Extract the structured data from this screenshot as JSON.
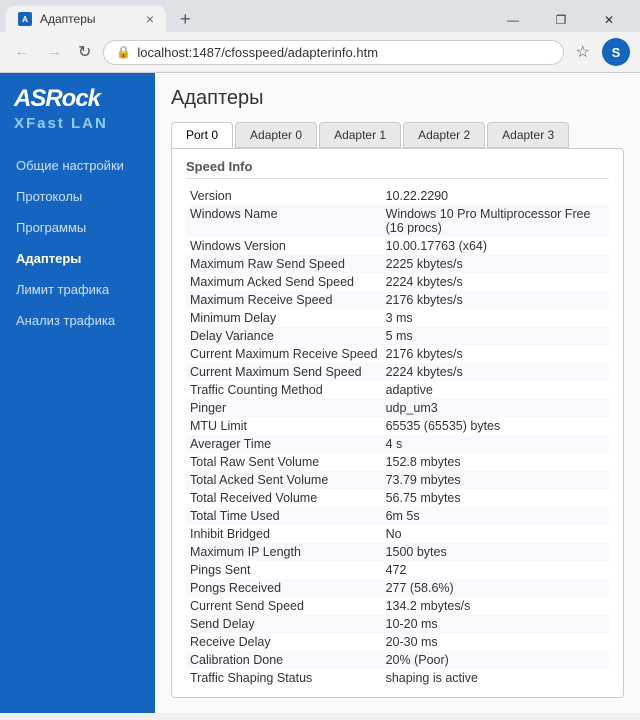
{
  "browser": {
    "tab_title": "Адаптеры",
    "tab_close": "×",
    "new_tab": "+",
    "back": "←",
    "forward": "→",
    "refresh": "↻",
    "url": "localhost:1487/cfosspeed/adapterinfo.htm",
    "star_icon": "☆",
    "profile_letter": "S",
    "win_minimize": "—",
    "win_restore": "❐",
    "win_close": "✕"
  },
  "sidebar": {
    "logo_main": "ASRock",
    "logo_sub": "XFast LAN",
    "items": [
      {
        "label": "Общие настройки",
        "active": false
      },
      {
        "label": "Протоколы",
        "active": false
      },
      {
        "label": "Программы",
        "active": false
      },
      {
        "label": "Адаптеры",
        "active": true
      },
      {
        "label": "Лимит трафика",
        "active": false
      },
      {
        "label": "Анализ трафика",
        "active": false
      }
    ]
  },
  "page": {
    "title": "Адаптеры",
    "tabs": [
      "Port 0",
      "Adapter 0",
      "Adapter 1",
      "Adapter 2",
      "Adapter 3"
    ],
    "active_tab": "Port 0",
    "section_label": "Speed Info",
    "rows": [
      {
        "label": "Version",
        "value": "10.22.2290"
      },
      {
        "label": "Windows Name",
        "value": "Windows 10 Pro Multiprocessor Free (16 procs)"
      },
      {
        "label": "Windows Version",
        "value": "10.00.17763 (x64)"
      },
      {
        "label": "Maximum Raw Send Speed",
        "value": "2225 kbytes/s"
      },
      {
        "label": "Maximum Acked Send Speed",
        "value": "2224 kbytes/s"
      },
      {
        "label": "Maximum Receive Speed",
        "value": "2176 kbytes/s"
      },
      {
        "label": "Minimum Delay",
        "value": "3 ms"
      },
      {
        "label": "Delay Variance",
        "value": "5 ms"
      },
      {
        "label": "Current Maximum Receive Speed",
        "value": "2176 kbytes/s"
      },
      {
        "label": "Current Maximum Send Speed",
        "value": "2224 kbytes/s"
      },
      {
        "label": "Traffic Counting Method",
        "value": "adaptive"
      },
      {
        "label": "Pinger",
        "value": "udp_um3"
      },
      {
        "label": "MTU Limit",
        "value": "65535 (65535) bytes"
      },
      {
        "label": "Averager Time",
        "value": "4 s"
      },
      {
        "label": "Total Raw Sent Volume",
        "value": "152.8 mbytes"
      },
      {
        "label": "Total Acked Sent Volume",
        "value": "73.79 mbytes"
      },
      {
        "label": "Total Received Volume",
        "value": "56.75 mbytes"
      },
      {
        "label": "Total Time Used",
        "value": "6m 5s"
      },
      {
        "label": "Inhibit Bridged",
        "value": "No"
      },
      {
        "label": "Maximum IP Length",
        "value": "1500 bytes"
      },
      {
        "label": "Pings Sent",
        "value": "472"
      },
      {
        "label": "Pongs Received",
        "value": "277 (58.6%)"
      },
      {
        "label": "Current Send Speed",
        "value": "134.2 mbytes/s"
      },
      {
        "label": "Send Delay",
        "value": "10-20 ms"
      },
      {
        "label": "Receive Delay",
        "value": "20-30 ms"
      },
      {
        "label": "Calibration Done",
        "value": "20% (Poor)"
      },
      {
        "label": "Traffic Shaping Status",
        "value": "shaping is active"
      }
    ]
  }
}
